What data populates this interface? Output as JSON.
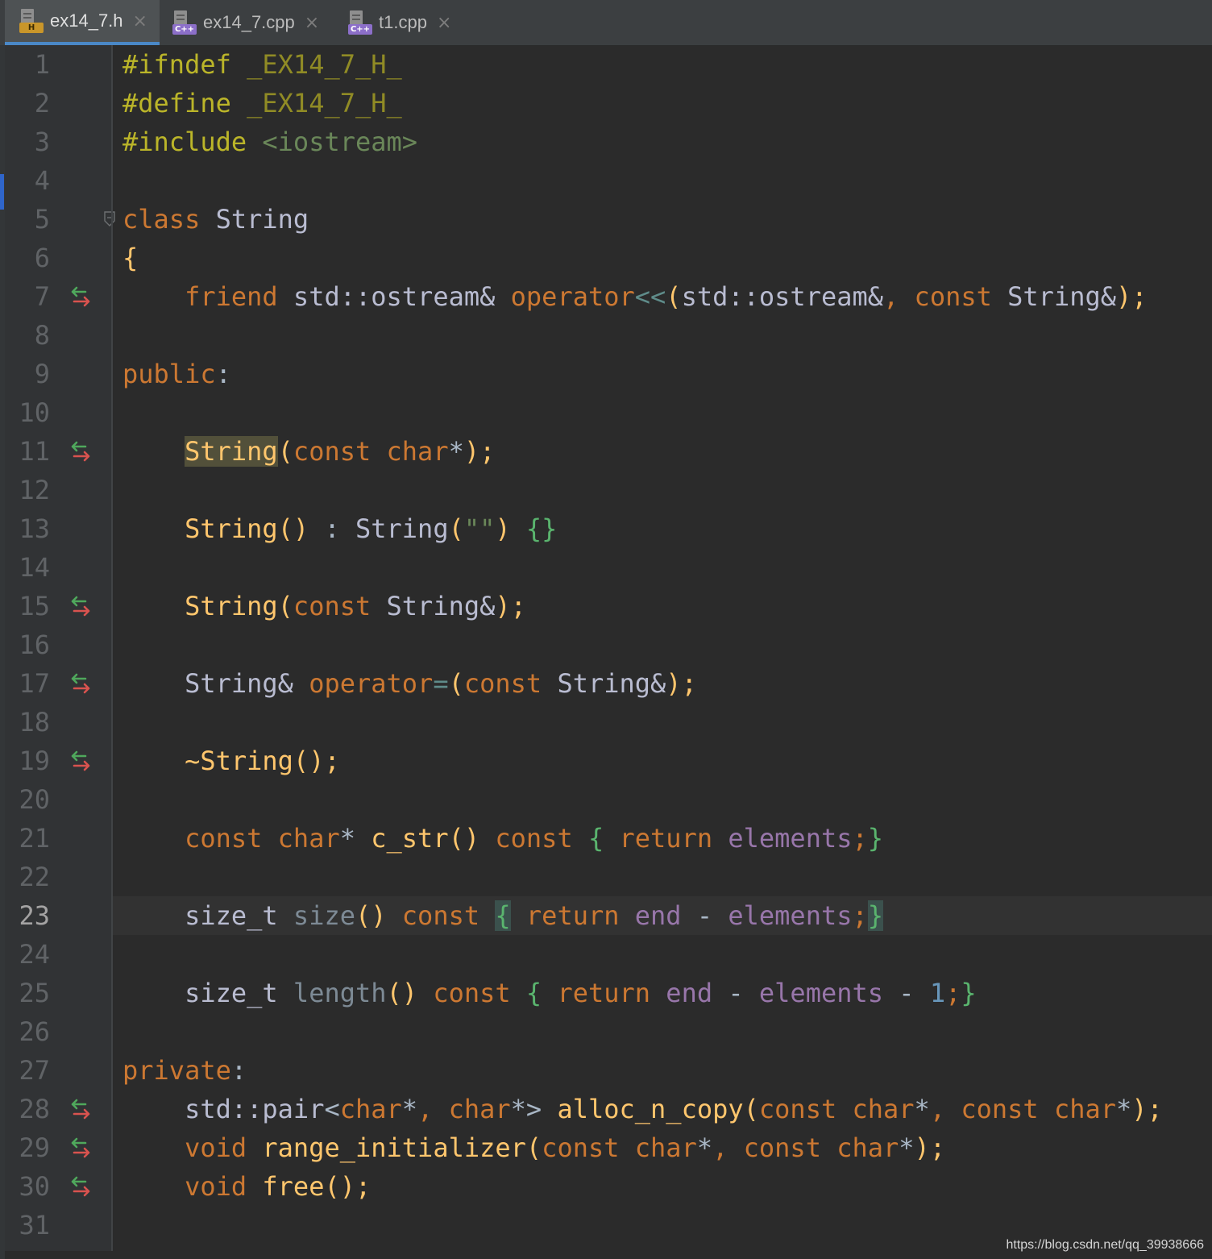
{
  "tabs": [
    {
      "label": "ex14_7.h",
      "badge": "H",
      "active": true
    },
    {
      "label": "ex14_7.cpp",
      "badge": "C++",
      "active": false
    },
    {
      "label": "t1.cpp",
      "badge": "C++",
      "active": false
    }
  ],
  "tab_close_glyph": "×",
  "current_line": 23,
  "override_marker_lines": [
    7,
    11,
    15,
    17,
    19,
    28,
    29,
    30
  ],
  "fold_marker_line": 5,
  "lines": [
    [
      {
        "t": "#ifndef ",
        "c": "pre"
      },
      {
        "t": "_EX14_7_H_",
        "c": "macro"
      }
    ],
    [
      {
        "t": "#define ",
        "c": "pre"
      },
      {
        "t": "_EX14_7_H_",
        "c": "macro"
      }
    ],
    [
      {
        "t": "#include ",
        "c": "pre"
      },
      {
        "t": "<iostream>",
        "c": "str"
      }
    ],
    [],
    [
      {
        "t": "class ",
        "c": "kw"
      },
      {
        "t": "String",
        "c": "type"
      }
    ],
    [
      {
        "t": "{",
        "c": "fn"
      }
    ],
    [
      {
        "t": "    friend ",
        "c": "kw"
      },
      {
        "t": "std::ostream& ",
        "c": "type"
      },
      {
        "t": "operator",
        "c": "kw"
      },
      {
        "t": "<<",
        "c": "op"
      },
      {
        "t": "(",
        "c": "fn"
      },
      {
        "t": "std::ostream&",
        "c": "type"
      },
      {
        "t": ", const ",
        "c": "kw"
      },
      {
        "t": "String&",
        "c": "type"
      },
      {
        "t": ");",
        "c": "fn"
      }
    ],
    [],
    [
      {
        "t": "public",
        "c": "kw"
      },
      {
        "t": ":",
        "c": "txt"
      }
    ],
    [],
    [
      {
        "t": "    ",
        "c": "txt"
      },
      {
        "t": "String",
        "c": "fn",
        "hl": true
      },
      {
        "t": "(",
        "c": "fn"
      },
      {
        "t": "const char",
        "c": "kw"
      },
      {
        "t": "*",
        "c": "txt"
      },
      {
        "t": ");",
        "c": "fn"
      }
    ],
    [],
    [
      {
        "t": "    String",
        "c": "fn"
      },
      {
        "t": "() ",
        "c": "fn"
      },
      {
        "t": ": ",
        "c": "txt"
      },
      {
        "t": "String",
        "c": "type"
      },
      {
        "t": "(",
        "c": "fn"
      },
      {
        "t": "\"\"",
        "c": "str"
      },
      {
        "t": ") ",
        "c": "fn"
      },
      {
        "t": "{}",
        "c": "brace"
      }
    ],
    [],
    [
      {
        "t": "    String",
        "c": "fn"
      },
      {
        "t": "(",
        "c": "fn"
      },
      {
        "t": "const ",
        "c": "kw"
      },
      {
        "t": "String&",
        "c": "type"
      },
      {
        "t": ");",
        "c": "fn"
      }
    ],
    [],
    [
      {
        "t": "    String& ",
        "c": "type"
      },
      {
        "t": "operator",
        "c": "kw"
      },
      {
        "t": "=",
        "c": "op"
      },
      {
        "t": "(",
        "c": "fn"
      },
      {
        "t": "const ",
        "c": "kw"
      },
      {
        "t": "String&",
        "c": "type"
      },
      {
        "t": ");",
        "c": "fn"
      }
    ],
    [],
    [
      {
        "t": "    ~String",
        "c": "fn"
      },
      {
        "t": "();",
        "c": "fn"
      }
    ],
    [],
    [
      {
        "t": "    const char",
        "c": "kw"
      },
      {
        "t": "* ",
        "c": "txt"
      },
      {
        "t": "c_str",
        "c": "fn"
      },
      {
        "t": "() ",
        "c": "fn"
      },
      {
        "t": "const ",
        "c": "kw"
      },
      {
        "t": "{ ",
        "c": "brace"
      },
      {
        "t": "return ",
        "c": "kw"
      },
      {
        "t": "elements",
        "c": "field"
      },
      {
        "t": ";",
        "c": "kw"
      },
      {
        "t": "}",
        "c": "brace"
      }
    ],
    [],
    [
      {
        "t": "    size_t ",
        "c": "type"
      },
      {
        "t": "size",
        "c": "gray"
      },
      {
        "t": "() ",
        "c": "fn"
      },
      {
        "t": "const ",
        "c": "kw"
      },
      {
        "t": "{",
        "c": "brace",
        "match": true
      },
      {
        "t": " return ",
        "c": "kw"
      },
      {
        "t": "end ",
        "c": "field"
      },
      {
        "t": "- ",
        "c": "txt"
      },
      {
        "t": "elements",
        "c": "field"
      },
      {
        "t": ";",
        "c": "kw"
      },
      {
        "t": "}",
        "c": "brace",
        "match": true
      }
    ],
    [],
    [
      {
        "t": "    size_t ",
        "c": "type"
      },
      {
        "t": "length",
        "c": "gray"
      },
      {
        "t": "() ",
        "c": "fn"
      },
      {
        "t": "const ",
        "c": "kw"
      },
      {
        "t": "{ ",
        "c": "brace"
      },
      {
        "t": "return ",
        "c": "kw"
      },
      {
        "t": "end ",
        "c": "field"
      },
      {
        "t": "- ",
        "c": "txt"
      },
      {
        "t": "elements ",
        "c": "field"
      },
      {
        "t": "- ",
        "c": "txt"
      },
      {
        "t": "1",
        "c": "num"
      },
      {
        "t": ";",
        "c": "kw"
      },
      {
        "t": "}",
        "c": "brace"
      }
    ],
    [],
    [
      {
        "t": "private",
        "c": "kw"
      },
      {
        "t": ":",
        "c": "txt"
      }
    ],
    [
      {
        "t": "    std::pair",
        "c": "type"
      },
      {
        "t": "<",
        "c": "txt"
      },
      {
        "t": "char",
        "c": "kw"
      },
      {
        "t": "*",
        "c": "txt"
      },
      {
        "t": ", ",
        "c": "kw"
      },
      {
        "t": "char",
        "c": "kw"
      },
      {
        "t": "*> ",
        "c": "txt"
      },
      {
        "t": "alloc_n_copy",
        "c": "fn"
      },
      {
        "t": "(",
        "c": "fn"
      },
      {
        "t": "const char",
        "c": "kw"
      },
      {
        "t": "*",
        "c": "txt"
      },
      {
        "t": ", const char",
        "c": "kw"
      },
      {
        "t": "*",
        "c": "txt"
      },
      {
        "t": ");",
        "c": "fn"
      }
    ],
    [
      {
        "t": "    void ",
        "c": "kw"
      },
      {
        "t": "range_initializer",
        "c": "fn"
      },
      {
        "t": "(",
        "c": "fn"
      },
      {
        "t": "const char",
        "c": "kw"
      },
      {
        "t": "*",
        "c": "txt"
      },
      {
        "t": ", const char",
        "c": "kw"
      },
      {
        "t": "*",
        "c": "txt"
      },
      {
        "t": ");",
        "c": "fn"
      }
    ],
    [
      {
        "t": "    void ",
        "c": "kw"
      },
      {
        "t": "free",
        "c": "fn"
      },
      {
        "t": "();",
        "c": "fn"
      }
    ],
    []
  ],
  "watermark": "https://blog.csdn.net/qq_39938666"
}
